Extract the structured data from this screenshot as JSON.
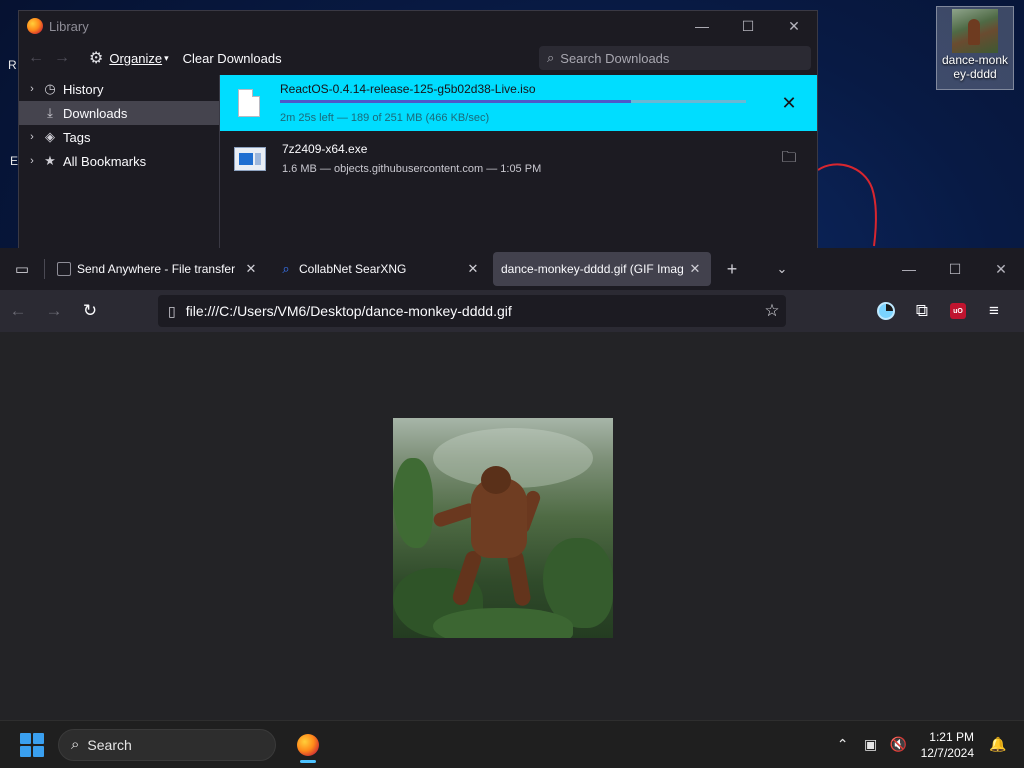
{
  "desktop": {
    "edge_text_1": "R",
    "edge_text_2": "E",
    "icon_label": "dance-monkey-dddd"
  },
  "library": {
    "title": "Library",
    "toolbar": {
      "organize_label": "Organize",
      "clear_downloads_label": "Clear Downloads",
      "search_placeholder": "Search Downloads"
    },
    "sidebar": [
      {
        "label": "History",
        "icon": "clock-icon",
        "glyph": "🕒",
        "expandable": true
      },
      {
        "label": "Downloads",
        "icon": "download-icon",
        "glyph": "⤓",
        "expandable": false,
        "active": true
      },
      {
        "label": "Tags",
        "icon": "tag-icon",
        "glyph": "🏷",
        "expandable": true
      },
      {
        "label": "All Bookmarks",
        "icon": "star-icon",
        "glyph": "★",
        "expandable": true
      }
    ],
    "downloads": [
      {
        "name": "ReactOS-0.4.14-release-125-g5b02d38-Live.iso",
        "status": "2m 25s left — 189 of 251 MB (466 KB/sec)",
        "progress": 0.753,
        "action_icon": "cancel-icon",
        "selected": true
      },
      {
        "name": "7z2409-x64.exe",
        "status": "1.6 MB — objects.githubusercontent.com — 1:05 PM",
        "action_icon": "folder-icon",
        "selected": false
      }
    ]
  },
  "browser": {
    "tabs": [
      {
        "title": "Send Anywhere - File transfer",
        "favicon": "page-icon",
        "active": false
      },
      {
        "title": "CollabNet SearXNG",
        "favicon": "search-icon",
        "active": false
      },
      {
        "title": "dance-monkey-dddd.gif (GIF Imag",
        "favicon": "none",
        "active": true
      }
    ],
    "url": "file:///C:/Users/VM6/Desktop/dance-monkey-dddd.gif"
  },
  "taskbar": {
    "search_label": "Search",
    "time": "1:21 PM",
    "date": "12/7/2024"
  },
  "colors": {
    "download_highlight": "#00ddff",
    "progress_fill": "#4f59c9",
    "toolbar_bg": "#2b2a33",
    "active_tab": "#42414d",
    "windows_accent": "#3aa0f0"
  }
}
